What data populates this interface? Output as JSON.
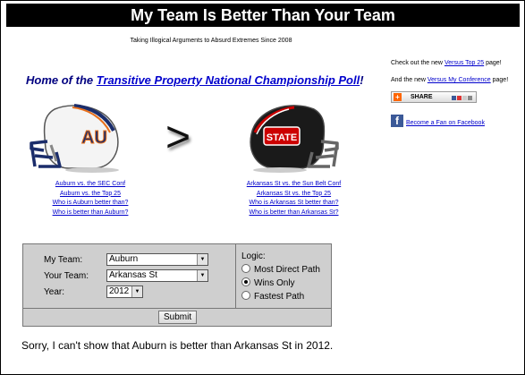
{
  "header": {
    "title": "My Team Is Better Than Your Team",
    "tagline": "Taking Illogical Arguments to Absurd Extremes Since 2008"
  },
  "home": {
    "prefix": "Home of the ",
    "link": "Transitive Property National Championship Poll",
    "suffix": "!"
  },
  "sidebar": {
    "top25_prefix": "Check out the new ",
    "top25_link": "Versus Top 25",
    "top25_suffix": " page!",
    "conf_prefix": "And the new ",
    "conf_link": "Versus My Conference",
    "conf_suffix": " page!",
    "share_label": "SHARE",
    "facebook_link": "Become a Fan on Facebook"
  },
  "comparison": {
    "symbol": ">",
    "left_links": [
      "Auburn vs. the SEC Conf",
      "Auburn vs. the Top 25",
      "Who is Auburn better than?",
      "Who is better than Auburn?"
    ],
    "right_links": [
      "Arkansas St vs. the Sun Belt Conf",
      "Arkansas St vs. the Top 25",
      "Who is Arkansas St better than?",
      "Who is better than Arkansas St?"
    ]
  },
  "helmets": {
    "left_lettering": "AU",
    "right_lettering": "STATE"
  },
  "form": {
    "my_team_label": "My Team:",
    "my_team_value": "Auburn",
    "your_team_label": "Your Team:",
    "your_team_value": "Arkansas St",
    "year_label": "Year:",
    "year_value": "2012",
    "logic_label": "Logic:",
    "logic_options": [
      "Most Direct Path",
      "Wins Only",
      "Fastest Path"
    ],
    "logic_selected": "Wins Only",
    "submit_label": "Submit"
  },
  "result": "Sorry, I can't show that Auburn is better than Arkansas St in 2012.",
  "colors": {
    "banner_bg": "#000000",
    "link": "#0000cc",
    "home_text": "#000080",
    "form_bg": "#cfcfcf",
    "auburn_orange": "#e86f1a",
    "auburn_navy": "#1b2d6b",
    "arkst_red": "#cc0000",
    "facebook_blue": "#3b5998"
  }
}
